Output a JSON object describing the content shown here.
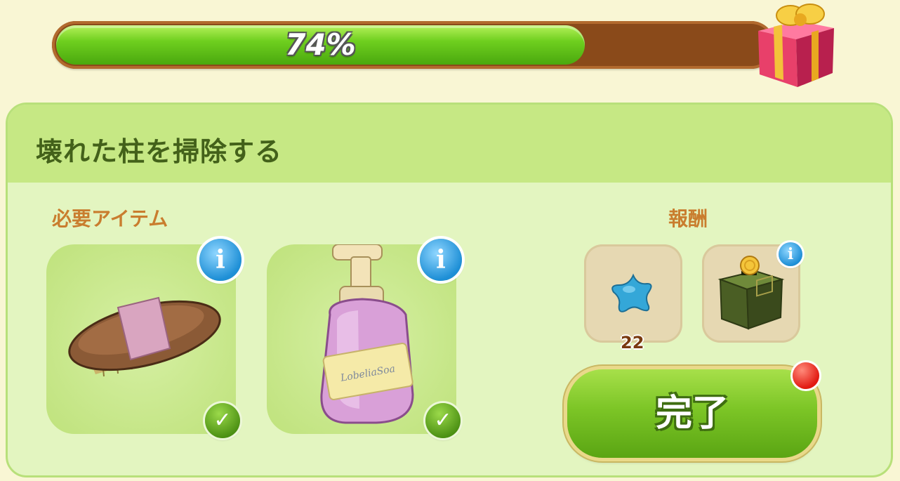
{
  "progress": {
    "value": 0.74,
    "label": "74%"
  },
  "task": {
    "title": "壊れた柱を掃除する"
  },
  "required": {
    "label": "必要アイテム",
    "items": [
      {
        "icon": "brush-icon",
        "completed": true
      },
      {
        "icon": "soap-bottle-icon",
        "completed": true,
        "bottle_text": "LobeliaSoa"
      }
    ]
  },
  "rewards": {
    "label": "報酬",
    "items": [
      {
        "icon": "blue-star-icon",
        "count": "22"
      },
      {
        "icon": "coin-box-icon"
      }
    ]
  },
  "complete_button": {
    "label": "完了"
  },
  "icons": {
    "info": "i",
    "check": "✓"
  },
  "colors": {
    "progress_fill": "#6fcf1f",
    "panel": "#e3f5c0",
    "accent_text": "#c97d2e"
  }
}
